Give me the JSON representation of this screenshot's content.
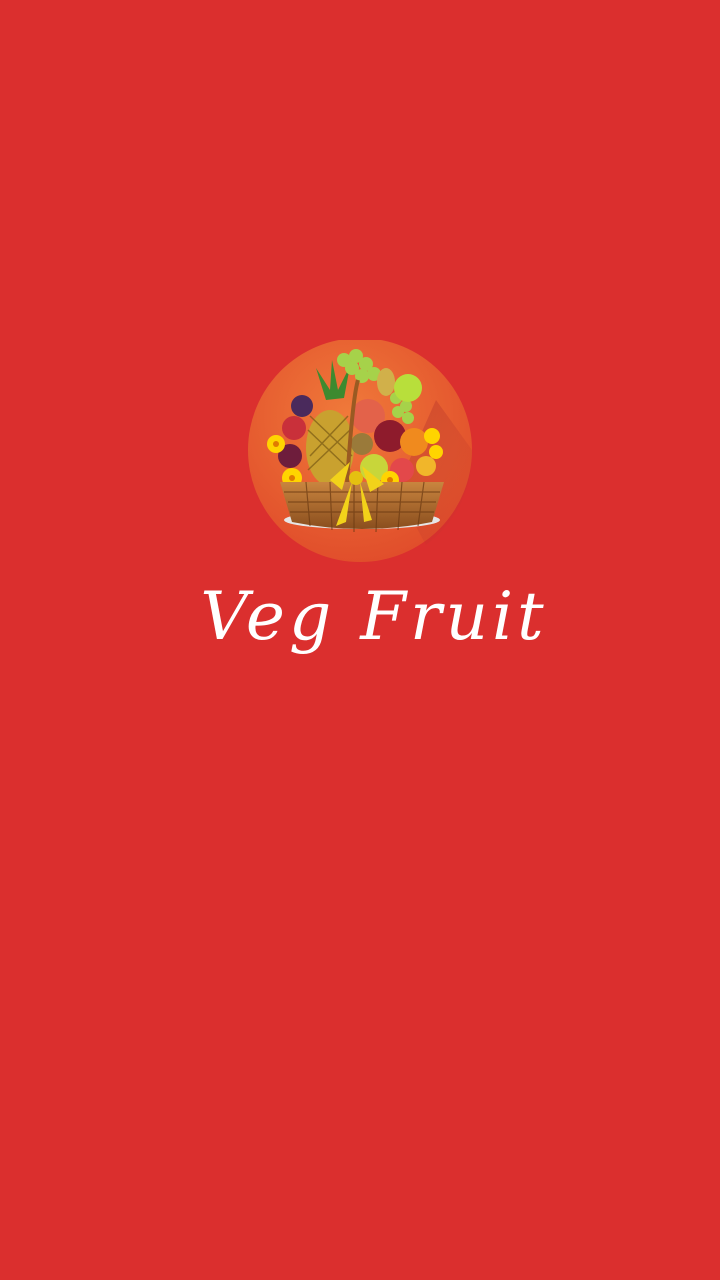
{
  "splash": {
    "app_name": "Veg Fruit",
    "logo_icon": "fruit-basket-icon",
    "background_color": "#db2f2e",
    "logo_circle_color": "#e8532b"
  }
}
